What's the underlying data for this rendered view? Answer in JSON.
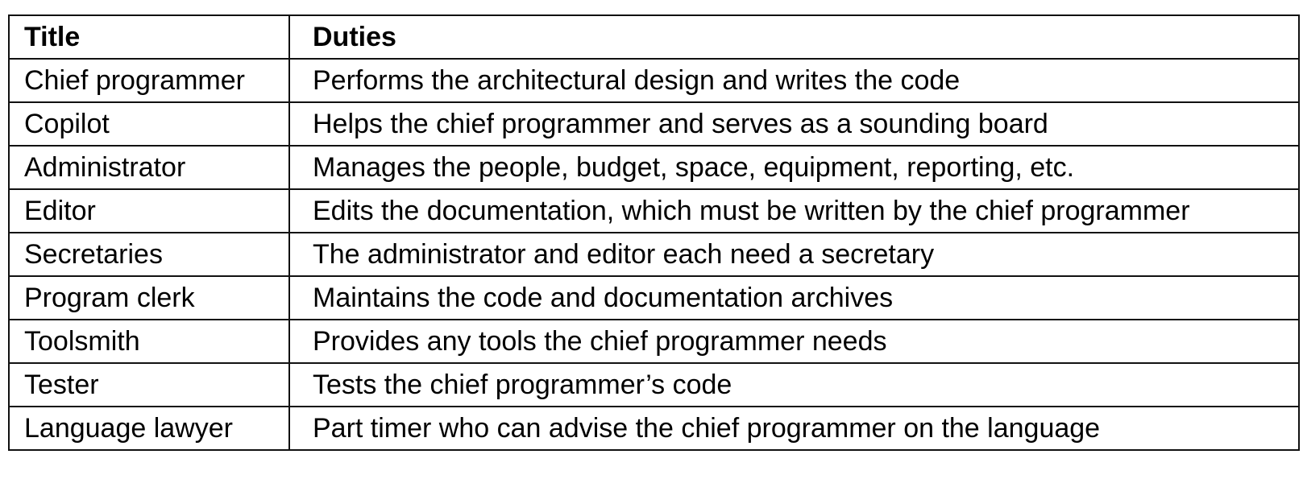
{
  "table": {
    "headers": {
      "title": "Title",
      "duties": "Duties"
    },
    "rows": [
      {
        "title": "Chief programmer",
        "duties": "Performs the architectural design and writes the code"
      },
      {
        "title": "Copilot",
        "duties": "Helps the chief programmer and serves as a sounding board"
      },
      {
        "title": "Administrator",
        "duties": "Manages the people, budget, space, equipment, reporting, etc."
      },
      {
        "title": "Editor",
        "duties": "Edits the documentation, which must be written by the chief programmer"
      },
      {
        "title": "Secretaries",
        "duties": "The administrator and editor each need a secretary"
      },
      {
        "title": "Program clerk",
        "duties": "Maintains the code and documentation archives"
      },
      {
        "title": "Toolsmith",
        "duties": "Provides any tools the chief programmer needs"
      },
      {
        "title": "Tester",
        "duties": "Tests the chief programmer’s code"
      },
      {
        "title": "Language lawyer",
        "duties": "Part timer who can advise the chief programmer on the language"
      }
    ]
  }
}
